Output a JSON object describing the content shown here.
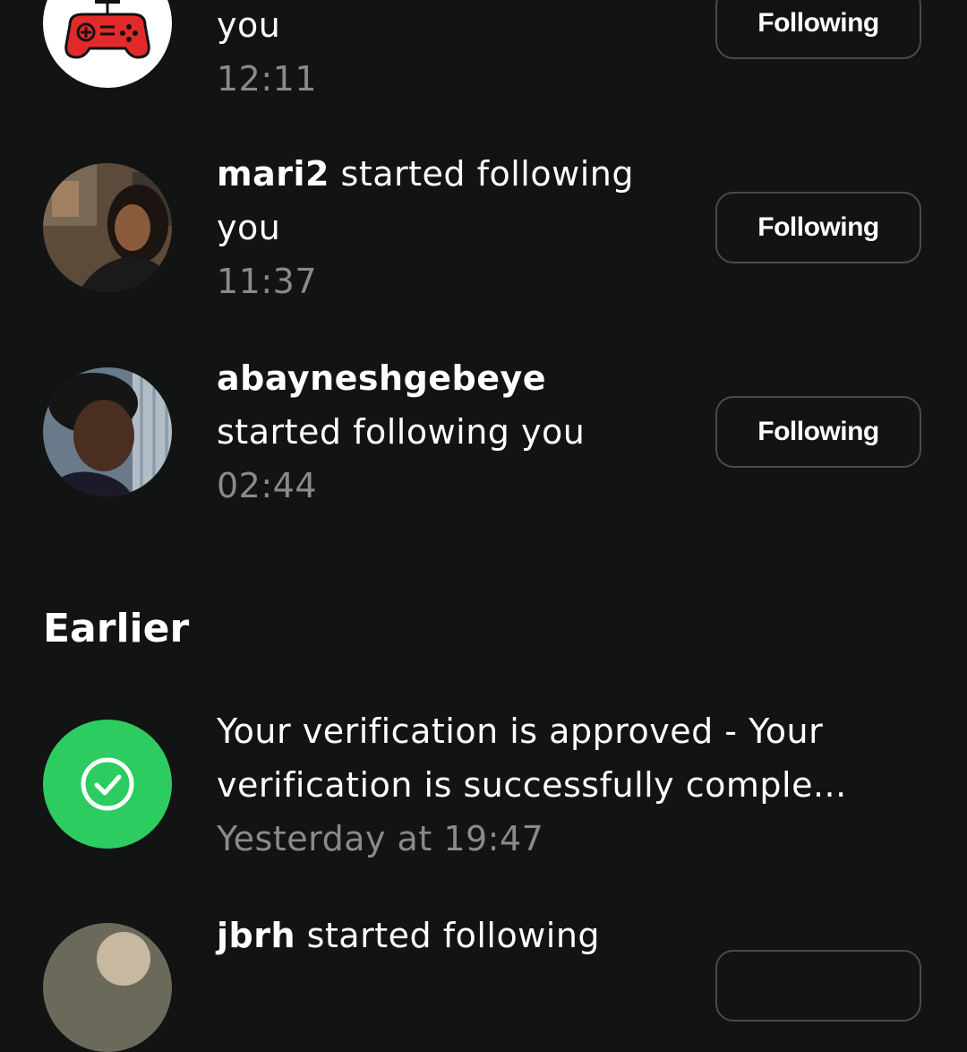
{
  "notifications": [
    {
      "lines": [
        "",
        "you"
      ],
      "time": "12:11",
      "button": "Following",
      "avatar": "gamepad-icon"
    },
    {
      "username": "mari2",
      "action_inline": " started following",
      "line2": "you",
      "time": "11:37",
      "button": "Following"
    },
    {
      "username": "abayneshgebeye",
      "line2": "started following you",
      "time": "02:44",
      "button": "Following"
    }
  ],
  "earlier": {
    "title": "Earlier",
    "verification": {
      "line1": "Your verification is approved - Your",
      "line2": "verification is successfully comple...",
      "time": "Yesterday at 19:47",
      "icon": "check-circle-icon",
      "icon_color": "#2dcc60"
    },
    "next": {
      "username": "jbrh",
      "action_inline": " started following"
    }
  }
}
